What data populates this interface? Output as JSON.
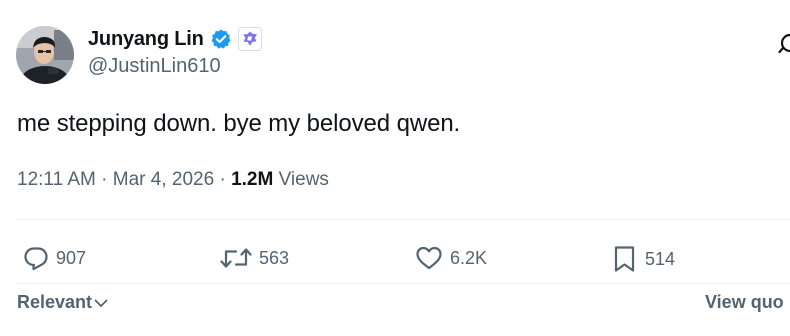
{
  "author": {
    "display_name": "Junyang Lin",
    "handle": "@JustinLin610",
    "verified_icon": "blue-verified-check-icon",
    "affiliate_icon": "qwen-logo-icon",
    "avatar": "profile-avatar"
  },
  "tweet": {
    "text": "me stepping down. bye my beloved qwen."
  },
  "meta": {
    "time": "12:11 AM",
    "separator1": " · ",
    "date": "Mar 4, 2026",
    "separator2": " · ",
    "views_count": "1.2M",
    "views_label": " Views"
  },
  "actions": {
    "replies": "907",
    "reposts": "563",
    "likes": "6.2K",
    "bookmarks": "514"
  },
  "footer": {
    "sort_label": "Relevant",
    "view_quotes_label": "View quo"
  },
  "colors": {
    "text_primary": "#0f1419",
    "text_secondary": "#536471",
    "verified_blue": "#1d9bf0",
    "divider": "#eff3f4"
  }
}
